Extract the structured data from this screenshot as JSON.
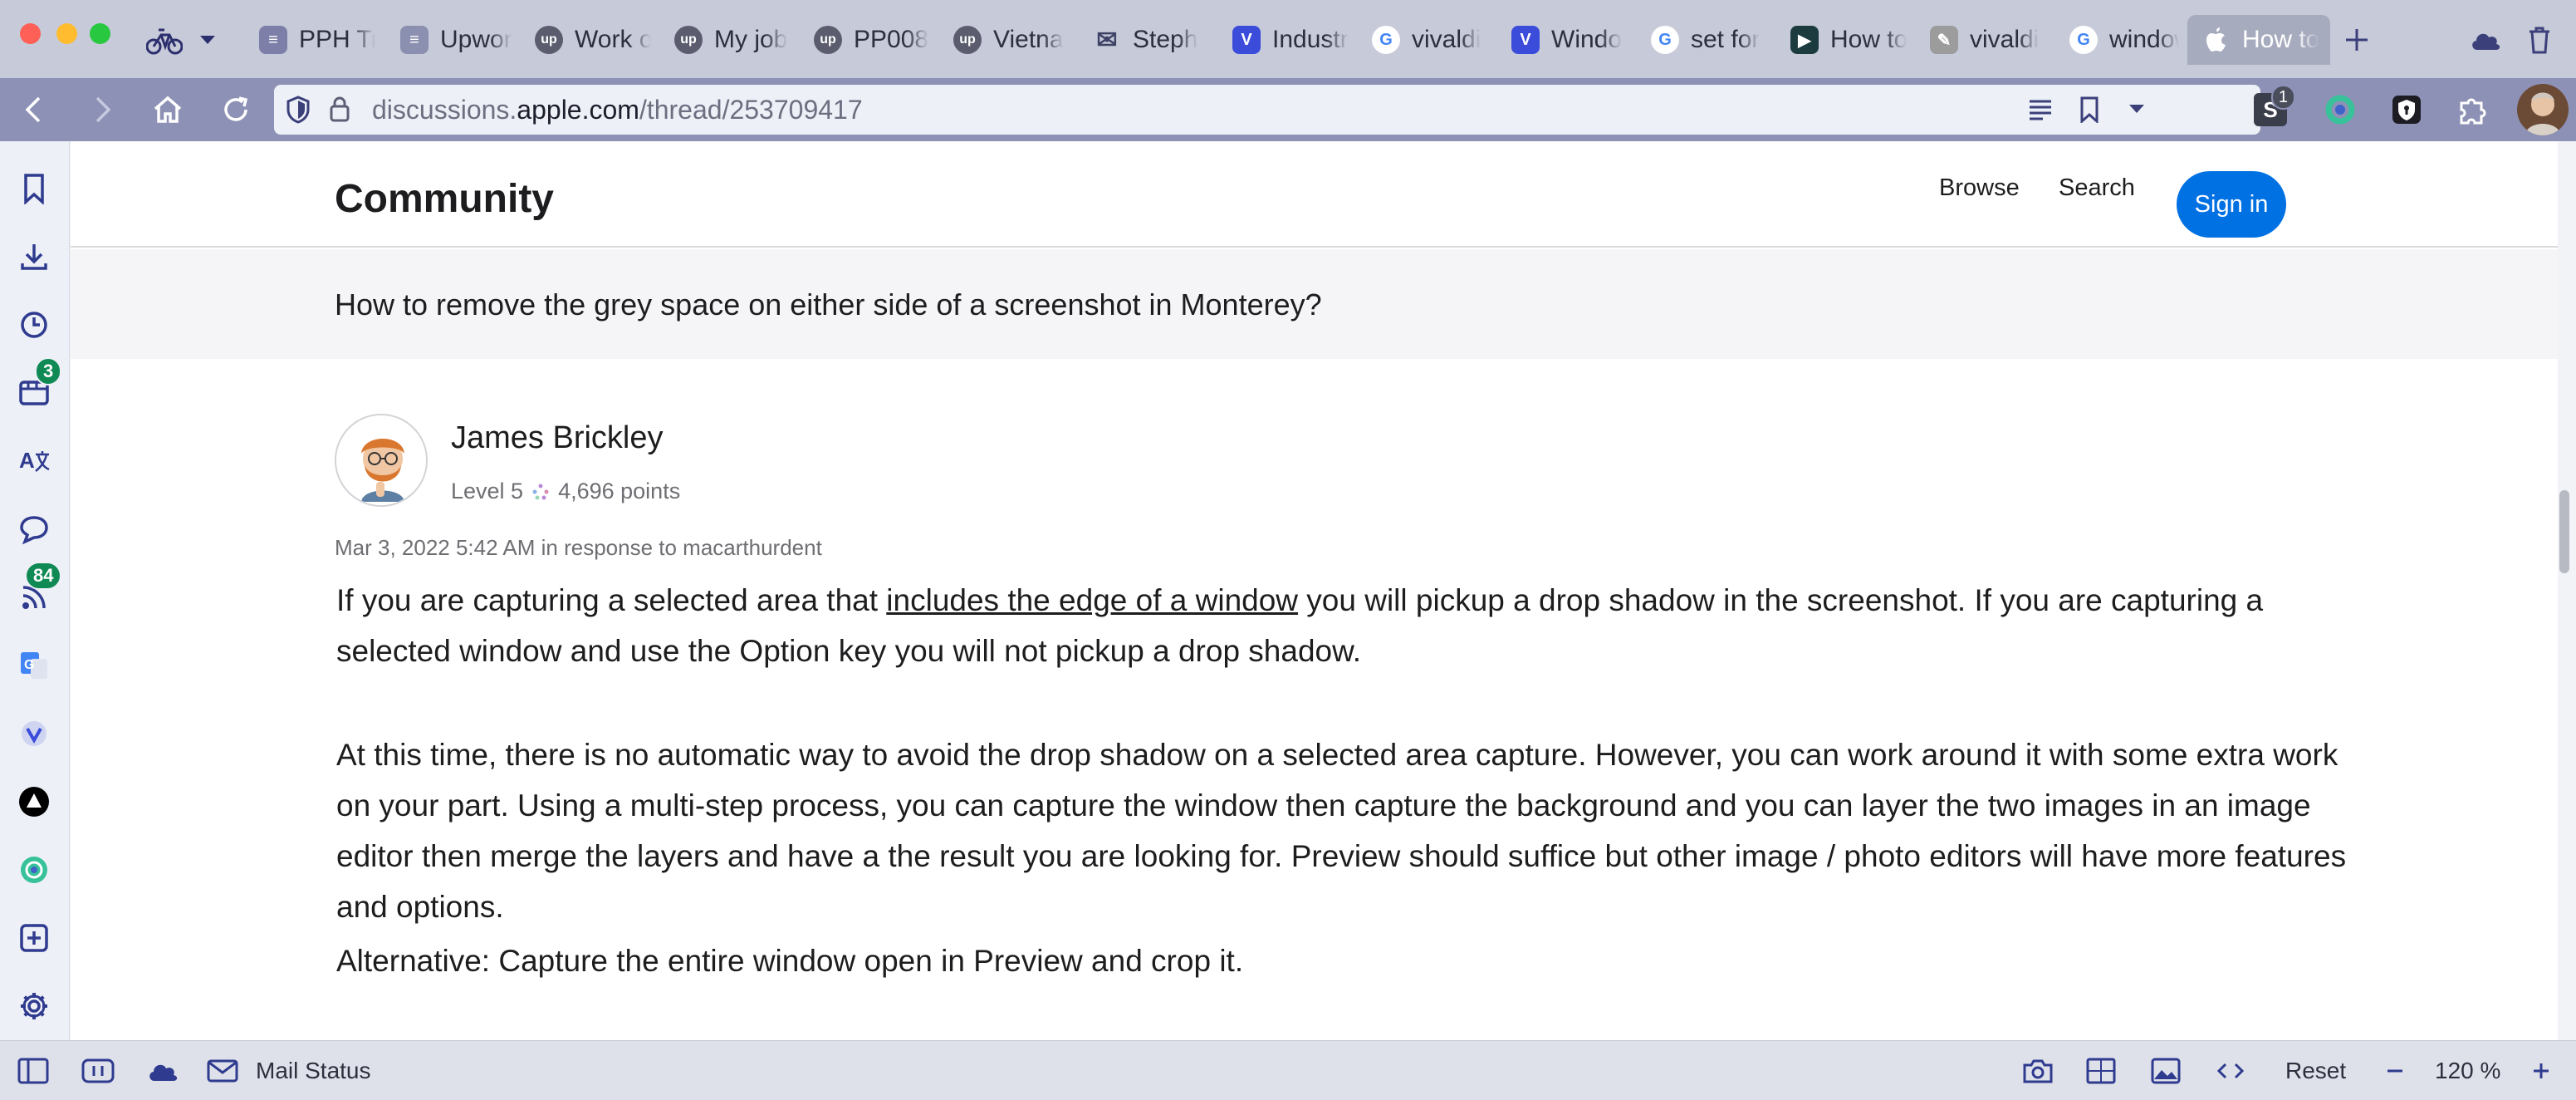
{
  "tabs": [
    {
      "label": "PPH Tr",
      "icon": "list-icon",
      "color": "#7d7fa8"
    },
    {
      "label": "Upwor",
      "icon": "doc-icon",
      "color": "#8b8fb0"
    },
    {
      "label": "Work o",
      "icon": "upwork-icon",
      "color": "#5b5d6e"
    },
    {
      "label": "My job",
      "icon": "upwork-icon",
      "color": "#5b5d6e"
    },
    {
      "label": "PP008",
      "icon": "upwork-icon",
      "color": "#5b5d6e"
    },
    {
      "label": "Vietna",
      "icon": "upwork-icon",
      "color": "#5b5d6e"
    },
    {
      "label": "Steph",
      "icon": "mail-icon",
      "color": "#3e4266"
    },
    {
      "label": "Industr",
      "icon": "vivaldi-icon",
      "color": "#3b4cdb"
    },
    {
      "label": "vivaldi",
      "icon": "google-icon",
      "color": "#4285f4"
    },
    {
      "label": "Windo",
      "icon": "vivaldi-icon",
      "color": "#3b4cdb"
    },
    {
      "label": "set for",
      "icon": "google-icon",
      "color": "#4285f4"
    },
    {
      "label": "How to",
      "icon": "play-icon",
      "color": "#1b3b3f"
    },
    {
      "label": "vivaldi",
      "icon": "drawing-icon",
      "color": "#9c9c9c"
    },
    {
      "label": "window",
      "icon": "google-icon",
      "color": "#4285f4"
    },
    {
      "label": "How to",
      "icon": "apple-icon",
      "color": "#ffffff"
    }
  ],
  "address": {
    "url_prefix": "discussions.",
    "url_domain": "apple.com",
    "url_path": "/thread/253709417"
  },
  "sidepanel": {
    "tabs_badge": "3",
    "feeds_badge": "84"
  },
  "extensions": {
    "s_badge": "1"
  },
  "page": {
    "site_title": "Community",
    "nav_browse": "Browse",
    "nav_search": "Search",
    "signin": "Sign in",
    "question": "How to remove the grey space on either side of a screenshot in Monterey?",
    "author": "James Brickley",
    "level": "Level 5",
    "points": "4,696 points",
    "date": "Mar 3, 2022 5:42 AM",
    "in_response": "in response to macarthurdent",
    "p1_before": "If you are capturing a selected area that ",
    "p1_link": "includes the edge of a window",
    "p1_after": " you will pickup a drop shadow in the screenshot.  If you are capturing a selected window and use the Option key you will not pickup a drop shadow.",
    "p2": "At this time, there is no automatic way to avoid the drop shadow on a selected area capture.  However, you can work around it with some extra work on your part.  Using a multi-step process, you can capture the window then capture the background and you can layer the two images in an image editor then merge the layers and have a the result you are looking for.  Preview should suffice but other image / photo editors will have more features and options.",
    "p3": "Alternative: Capture the entire window open in Preview and crop it."
  },
  "statusbar": {
    "mail_status": "Mail Status",
    "reset": "Reset",
    "zoom": "120 %"
  },
  "colors": {
    "accent": "#0071e3",
    "badge": "#0f8a55",
    "tabbar": "#c7cad8",
    "addressbar": "#8d91b5"
  }
}
